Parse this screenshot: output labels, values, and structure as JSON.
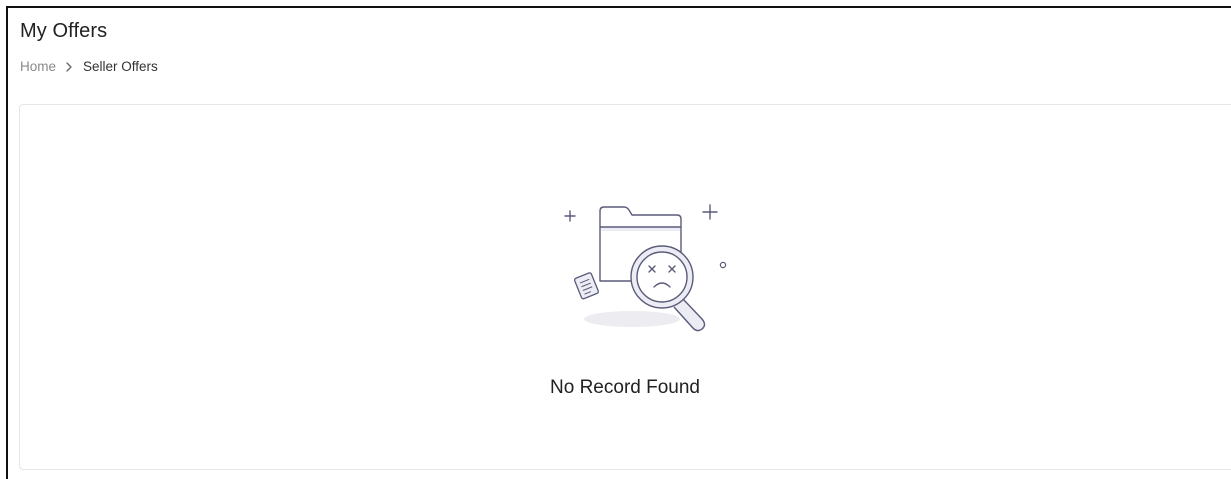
{
  "header": {
    "title": "My Offers"
  },
  "breadcrumb": {
    "items": [
      {
        "label": "Home"
      },
      {
        "label": "Seller Offers"
      }
    ],
    "separator_icon": "chevron-right-icon"
  },
  "empty_state": {
    "icon": "no-record-illustration-icon",
    "message": "No Record Found"
  },
  "colors": {
    "title_text": "#222222",
    "breadcrumb_home": "#8a8a8a",
    "breadcrumb_current": "#333333",
    "illustration_stroke": "#5a5a7a",
    "illustration_fill": "#ececf4",
    "card_border": "#e6e6e6"
  }
}
